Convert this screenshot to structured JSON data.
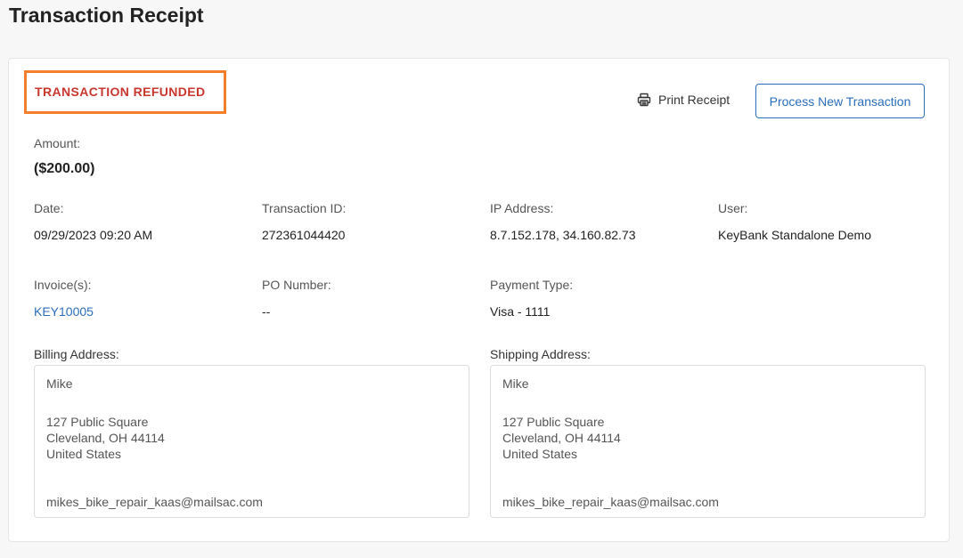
{
  "page": {
    "title": "Transaction Receipt"
  },
  "status": {
    "text": "TRANSACTION REFUNDED"
  },
  "actions": {
    "print_label": "Print Receipt",
    "new_transaction_label": "Process New Transaction"
  },
  "amount": {
    "label": "Amount:",
    "value": "($200.00)"
  },
  "details": {
    "date": {
      "label": "Date:",
      "value": "09/29/2023 09:20 AM"
    },
    "transaction_id": {
      "label": "Transaction ID:",
      "value": "272361044420"
    },
    "ip_address": {
      "label": "IP Address:",
      "value": "8.7.152.178, 34.160.82.73"
    },
    "user": {
      "label": "User:",
      "value": "KeyBank Standalone Demo"
    },
    "invoices": {
      "label": "Invoice(s):",
      "value": "KEY10005"
    },
    "po_number": {
      "label": "PO Number:",
      "value": "--"
    },
    "payment_type": {
      "label": "Payment Type:",
      "value": "Visa - 1111"
    }
  },
  "billing": {
    "label": "Billing Address:",
    "name": "Mike",
    "street": "127 Public Square",
    "city_line": "Cleveland, OH 44114",
    "country": "United States",
    "email": "mikes_bike_repair_kaas@mailsac.com"
  },
  "shipping": {
    "label": "Shipping Address:",
    "name": "Mike",
    "street": "127 Public Square",
    "city_line": "Cleveland, OH 44114",
    "country": "United States",
    "email": "mikes_bike_repair_kaas@mailsac.com"
  },
  "icons": {
    "print": "printer-icon"
  },
  "colors": {
    "status_text": "#c8362e",
    "status_border": "#f47e2a",
    "link": "#2a6ebb"
  }
}
